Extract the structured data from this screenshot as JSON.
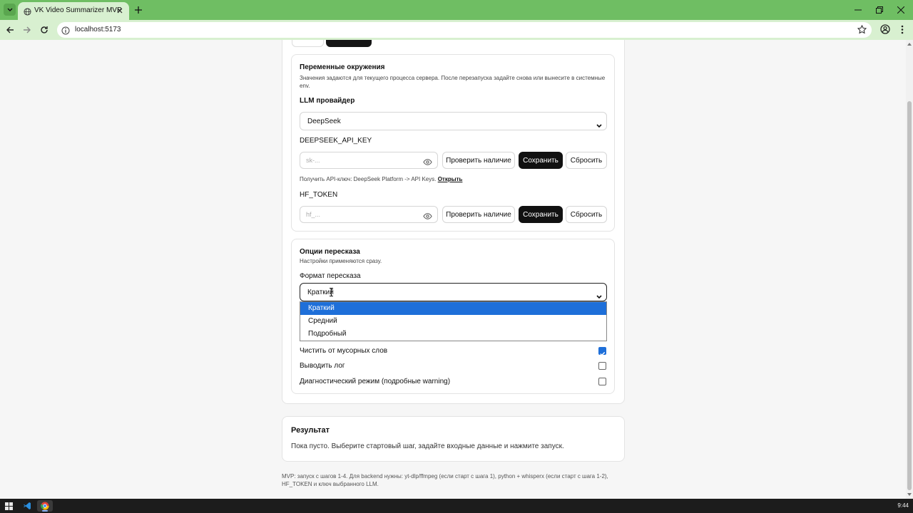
{
  "browser": {
    "tab_title": "VK Video Summarizer MVP",
    "url": "localhost:5173",
    "accent": "#6fbe63"
  },
  "env": {
    "title": "Переменные окружения",
    "description": "Значения задаются для текущего процесса сервера. После перезапуска задайте снова или вынесите в системные env.",
    "llm_label": "LLM провайдер",
    "llm_value": "DeepSeek",
    "deepseek_label": "DEEPSEEK_API_KEY",
    "deepseek_placeholder": "sk-...",
    "check_label": "Проверить наличие",
    "save_label": "Сохранить",
    "reset_label": "Сбросить",
    "hint_prefix": "Получить API-ключ: DeepSeek Platform -> API Keys.",
    "hint_link": "Открыть",
    "hf_label": "HF_TOKEN",
    "hf_placeholder": "hf_..."
  },
  "options": {
    "title": "Опции пересказа",
    "subtitle": "Настройки применяются сразу.",
    "format_label": "Формат пересказа",
    "format_value": "Краткий",
    "format_options": [
      "Краткий",
      "Средний",
      "Подробный"
    ],
    "selected_option_index": 0,
    "checkboxes": [
      {
        "label": "Чистить от мусорных слов",
        "checked": true
      },
      {
        "label": "Выводить лог",
        "checked": false
      },
      {
        "label": "Диагностический режим (подробные warning)",
        "checked": false
      }
    ]
  },
  "result": {
    "title": "Результат",
    "text": "Пока пусто. Выберите стартовый шаг, задайте входные данные и нажмите запуск."
  },
  "footer": "MVP: запуск с шагов 1-4. Для backend нужны: yt-dlp/ffmpeg (если старт с шага 1), python + whisperx (если старт с шага 1-2), HF_TOKEN и ключ выбранного LLM.",
  "taskbar": {
    "clock": "9:44"
  }
}
